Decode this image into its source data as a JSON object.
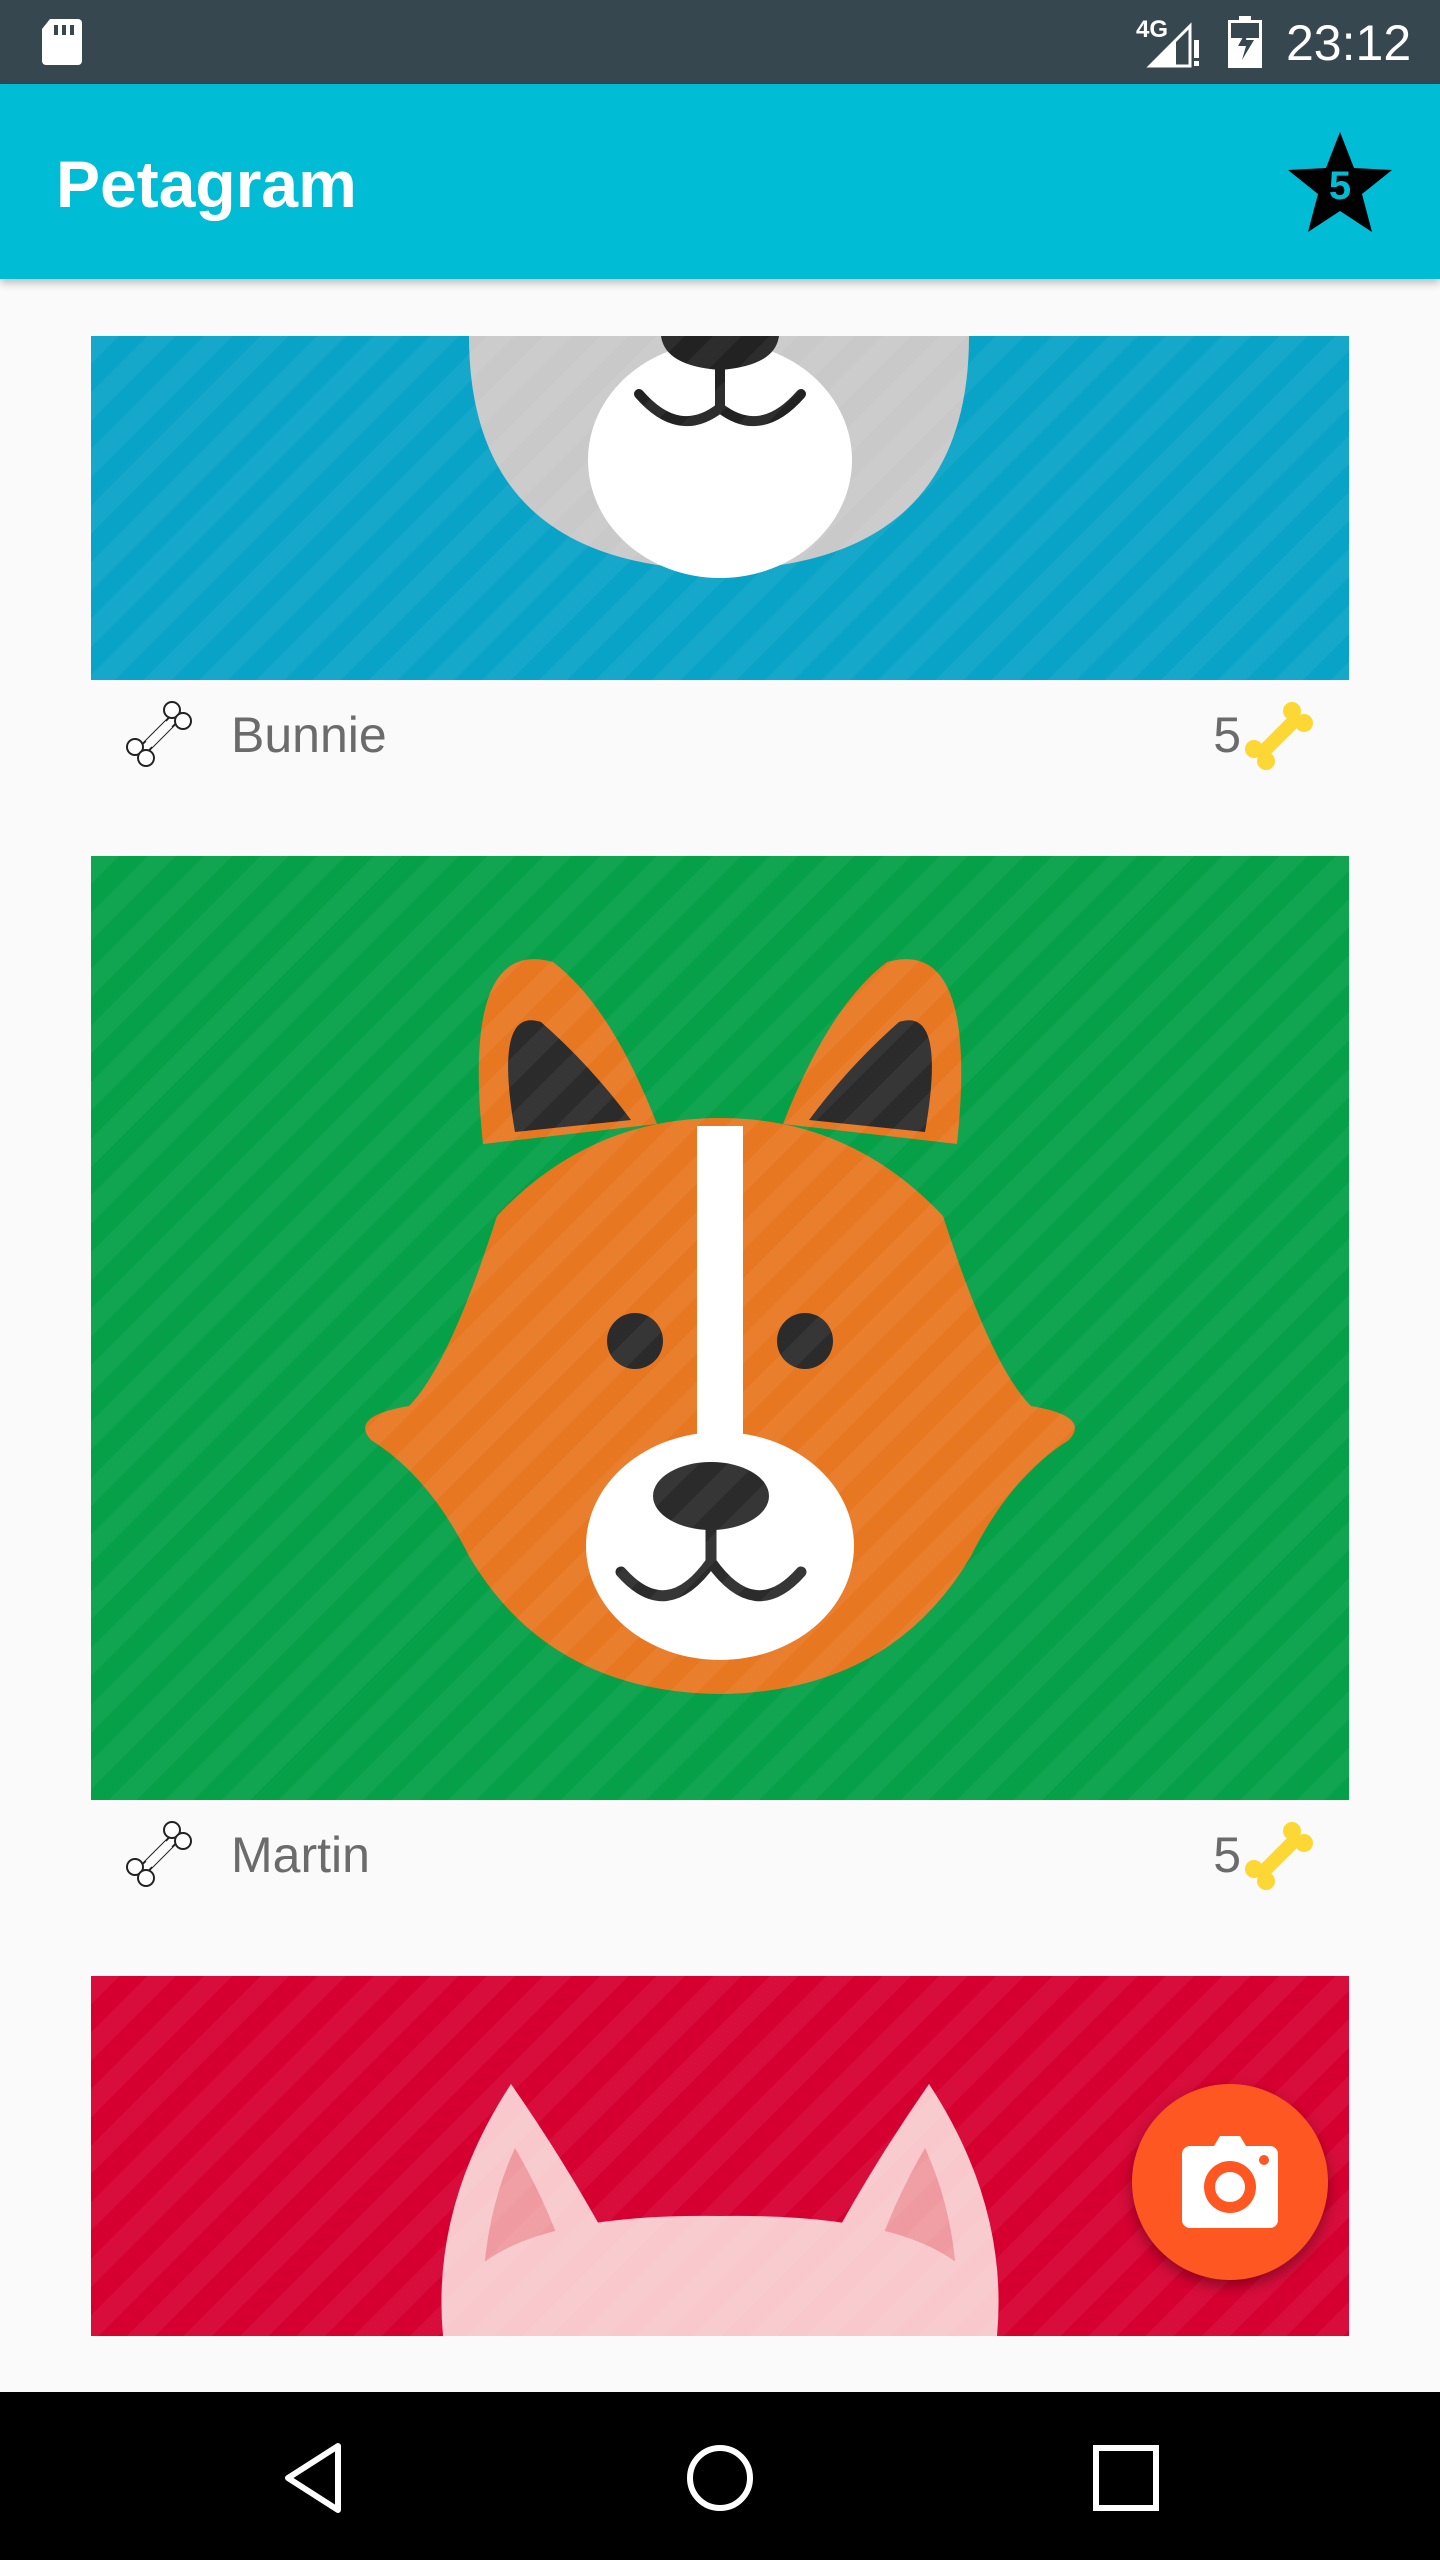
{
  "status_bar": {
    "network_type": "4G",
    "time": "23:12"
  },
  "app_bar": {
    "title": "Petagram",
    "favorites_count": "5",
    "colors": {
      "primary": "#00bcd4",
      "status": "#37474f"
    }
  },
  "pets": [
    {
      "name": "Bunnie",
      "likes": "5",
      "image_icon": "bunny-face",
      "background": "#0aa3c8"
    },
    {
      "name": "Martin",
      "likes": "5",
      "image_icon": "corgi-face",
      "background": "#05a048"
    },
    {
      "name": "",
      "likes": "",
      "image_icon": "cat-face",
      "background": "#d60030"
    }
  ],
  "icons": {
    "like": "bone-outline-icon",
    "rating": "bone-yellow-icon",
    "fab": "camera-icon",
    "favorites": "star-icon"
  },
  "fab": {
    "color": "#ff5722"
  },
  "nav_bar": {
    "back": "back-icon",
    "home": "home-icon",
    "recents": "recents-icon"
  }
}
